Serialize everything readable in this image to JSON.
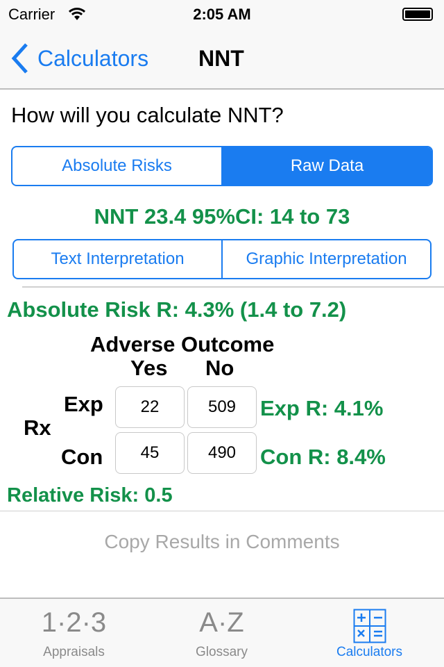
{
  "status": {
    "carrier": "Carrier",
    "time": "2:05 AM"
  },
  "nav": {
    "back": "Calculators",
    "title": "NNT"
  },
  "question": "How will you calculate NNT?",
  "mode": {
    "options": [
      "Absolute Risks",
      "Raw Data"
    ],
    "selected": "Raw Data"
  },
  "nnt_result": "NNT 23.4 95%CI: 14 to 73",
  "interpretation": {
    "options": [
      "Text Interpretation",
      "Graphic Interpretation"
    ]
  },
  "absolute_risk": "Absolute Risk R: 4.3% (1.4 to 7.2)",
  "table": {
    "header": "Adverse Outcome",
    "col_yes": "Yes",
    "col_no": "No",
    "row_group": "Rx",
    "rows": [
      {
        "label": "Exp",
        "yes": "22",
        "no": "509",
        "result": "Exp R: 4.1%"
      },
      {
        "label": "Con",
        "yes": "45",
        "no": "490",
        "result": "Con R: 8.4%"
      }
    ]
  },
  "relative_risk": "Relative Risk: 0.5",
  "copy_button": "Copy Results in Comments",
  "tabs": [
    {
      "label": "Appraisals",
      "icon": "1·2·3",
      "icon_name": "numbers-icon"
    },
    {
      "label": "Glossary",
      "icon": "A·Z",
      "icon_name": "az-icon"
    },
    {
      "label": "Calculators",
      "icon_name": "calculator-icon",
      "active": true
    }
  ],
  "colors": {
    "accent": "#1a7cf0",
    "result_green": "#13914a"
  }
}
